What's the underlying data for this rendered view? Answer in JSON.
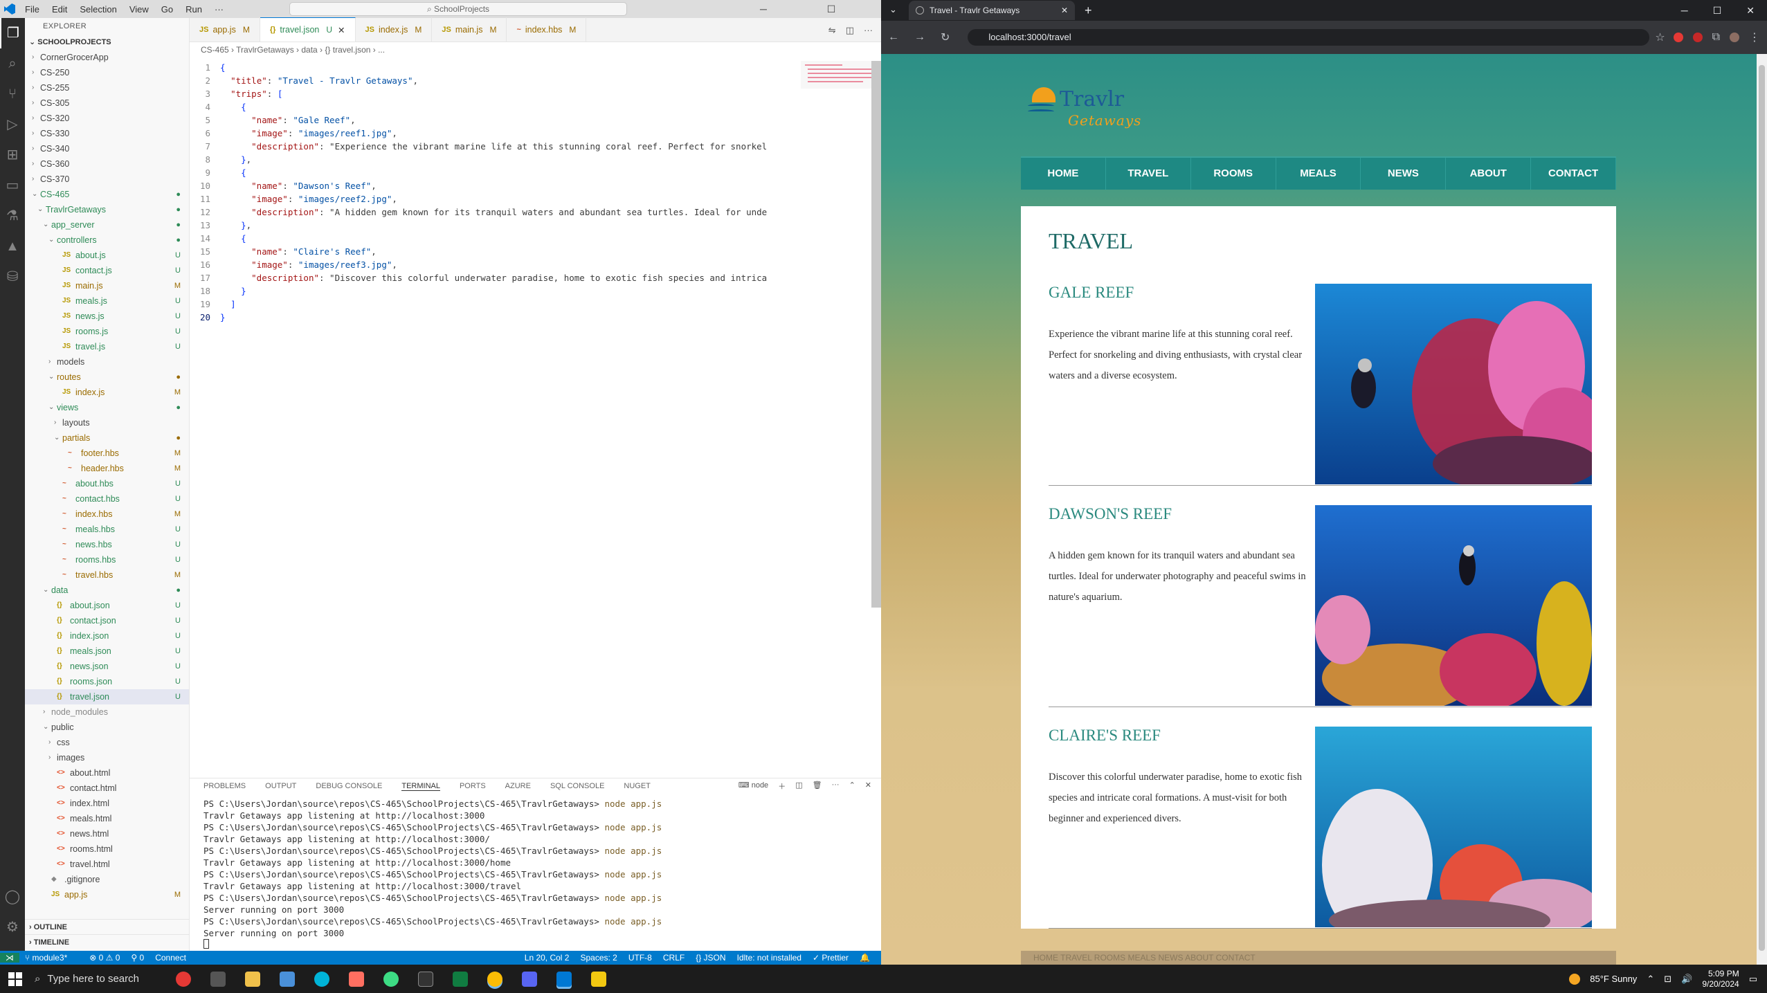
{
  "vscode": {
    "menu": [
      "File",
      "Edit",
      "Selection",
      "View",
      "Go",
      "Run",
      "···"
    ],
    "search_placeholder": "SchoolProjects",
    "explorer_title": "EXPLORER",
    "root": "SCHOOLPROJECTS",
    "tree": [
      {
        "label": "CornerGrocerApp",
        "depth": 1,
        "type": "folder"
      },
      {
        "label": "CS-250",
        "depth": 1,
        "type": "folder"
      },
      {
        "label": "CS-255",
        "depth": 1,
        "type": "folder"
      },
      {
        "label": "CS-305",
        "depth": 1,
        "type": "folder"
      },
      {
        "label": "CS-320",
        "depth": 1,
        "type": "folder"
      },
      {
        "label": "CS-330",
        "depth": 1,
        "type": "folder"
      },
      {
        "label": "CS-340",
        "depth": 1,
        "type": "folder"
      },
      {
        "label": "CS-360",
        "depth": 1,
        "type": "folder"
      },
      {
        "label": "CS-370",
        "depth": 1,
        "type": "folder"
      },
      {
        "label": "CS-465",
        "depth": 1,
        "type": "folder-open",
        "status": "dot"
      },
      {
        "label": "TravlrGetaways",
        "depth": 2,
        "type": "folder-open",
        "status": "dot"
      },
      {
        "label": "app_server",
        "depth": 3,
        "type": "folder-open",
        "status": "dot"
      },
      {
        "label": "controllers",
        "depth": 4,
        "type": "folder-open",
        "status": "dot"
      },
      {
        "label": "about.js",
        "depth": 5,
        "type": "js",
        "status": "U"
      },
      {
        "label": "contact.js",
        "depth": 5,
        "type": "js",
        "status": "U"
      },
      {
        "label": "main.js",
        "depth": 5,
        "type": "js",
        "status": "M"
      },
      {
        "label": "meals.js",
        "depth": 5,
        "type": "js",
        "status": "U"
      },
      {
        "label": "news.js",
        "depth": 5,
        "type": "js",
        "status": "U"
      },
      {
        "label": "rooms.js",
        "depth": 5,
        "type": "js",
        "status": "U"
      },
      {
        "label": "travel.js",
        "depth": 5,
        "type": "js",
        "status": "U"
      },
      {
        "label": "models",
        "depth": 4,
        "type": "folder"
      },
      {
        "label": "routes",
        "depth": 4,
        "type": "folder-open",
        "status": "dot-m"
      },
      {
        "label": "index.js",
        "depth": 5,
        "type": "js",
        "status": "M"
      },
      {
        "label": "views",
        "depth": 4,
        "type": "folder-open",
        "status": "dot"
      },
      {
        "label": "layouts",
        "depth": 5,
        "type": "folder"
      },
      {
        "label": "partials",
        "depth": 5,
        "type": "folder-open",
        "status": "dot-m"
      },
      {
        "label": "footer.hbs",
        "depth": 6,
        "type": "hbs",
        "status": "M"
      },
      {
        "label": "header.hbs",
        "depth": 6,
        "type": "hbs",
        "status": "M"
      },
      {
        "label": "about.hbs",
        "depth": 5,
        "type": "hbs",
        "status": "U"
      },
      {
        "label": "contact.hbs",
        "depth": 5,
        "type": "hbs",
        "status": "U"
      },
      {
        "label": "index.hbs",
        "depth": 5,
        "type": "hbs",
        "status": "M"
      },
      {
        "label": "meals.hbs",
        "depth": 5,
        "type": "hbs",
        "status": "U"
      },
      {
        "label": "news.hbs",
        "depth": 5,
        "type": "hbs",
        "status": "U"
      },
      {
        "label": "rooms.hbs",
        "depth": 5,
        "type": "hbs",
        "status": "U"
      },
      {
        "label": "travel.hbs",
        "depth": 5,
        "type": "hbs",
        "status": "M"
      },
      {
        "label": "data",
        "depth": 3,
        "type": "folder-open",
        "status": "dot"
      },
      {
        "label": "about.json",
        "depth": 4,
        "type": "json",
        "status": "U"
      },
      {
        "label": "contact.json",
        "depth": 4,
        "type": "json",
        "status": "U"
      },
      {
        "label": "index.json",
        "depth": 4,
        "type": "json",
        "status": "U"
      },
      {
        "label": "meals.json",
        "depth": 4,
        "type": "json",
        "status": "U"
      },
      {
        "label": "news.json",
        "depth": 4,
        "type": "json",
        "status": "U"
      },
      {
        "label": "rooms.json",
        "depth": 4,
        "type": "json",
        "status": "U"
      },
      {
        "label": "travel.json",
        "depth": 4,
        "type": "json",
        "status": "U",
        "selected": true
      },
      {
        "label": "node_modules",
        "depth": 3,
        "type": "folder",
        "muted": true
      },
      {
        "label": "public",
        "depth": 3,
        "type": "folder-open"
      },
      {
        "label": "css",
        "depth": 4,
        "type": "folder"
      },
      {
        "label": "images",
        "depth": 4,
        "type": "folder"
      },
      {
        "label": "about.html",
        "depth": 4,
        "type": "html"
      },
      {
        "label": "contact.html",
        "depth": 4,
        "type": "html"
      },
      {
        "label": "index.html",
        "depth": 4,
        "type": "html"
      },
      {
        "label": "meals.html",
        "depth": 4,
        "type": "html"
      },
      {
        "label": "news.html",
        "depth": 4,
        "type": "html"
      },
      {
        "label": "rooms.html",
        "depth": 4,
        "type": "html"
      },
      {
        "label": "travel.html",
        "depth": 4,
        "type": "html"
      },
      {
        "label": ".gitignore",
        "depth": 3,
        "type": "git"
      },
      {
        "label": "app.js",
        "depth": 3,
        "type": "js",
        "status": "M"
      }
    ],
    "outline_label": "OUTLINE",
    "timeline_label": "TIMELINE",
    "tabs": [
      {
        "label": "app.js",
        "status": "M",
        "icon": "JS"
      },
      {
        "label": "travel.json",
        "status": "U",
        "icon": "{}",
        "active": true
      },
      {
        "label": "index.js",
        "status": "M",
        "icon": "JS"
      },
      {
        "label": "main.js",
        "status": "M",
        "icon": "JS"
      },
      {
        "label": "index.hbs",
        "status": "M",
        "icon": "~"
      }
    ],
    "breadcrumb": "CS-465 › TravlrGetaways › data › {} travel.json › ...",
    "code": [
      "{",
      "  \"title\": \"Travel - Travlr Getaways\",",
      "  \"trips\": [",
      "    {",
      "      \"name\": \"Gale Reef\",",
      "      \"image\": \"images/reef1.jpg\",",
      "      \"description\": \"Experience the vibrant marine life at this stunning coral reef. Perfect for snorkel",
      "    },",
      "    {",
      "      \"name\": \"Dawson's Reef\",",
      "      \"image\": \"images/reef2.jpg\",",
      "      \"description\": \"A hidden gem known for its tranquil waters and abundant sea turtles. Ideal for unde",
      "    },",
      "    {",
      "      \"name\": \"Claire's Reef\",",
      "      \"image\": \"images/reef3.jpg\",",
      "      \"description\": \"Discover this colorful underwater paradise, home to exotic fish species and intrica",
      "    }",
      "  ]",
      "}"
    ],
    "panel_tabs": [
      "PROBLEMS",
      "OUTPUT",
      "DEBUG CONSOLE",
      "TERMINAL",
      "PORTS",
      "AZURE",
      "SQL CONSOLE",
      "NUGET"
    ],
    "panel_active": "TERMINAL",
    "terminal_shell": "node",
    "terminal": [
      {
        "prompt": "PS C:\\Users\\Jordan\\source\\repos\\CS-465\\SchoolProjects\\CS-465\\TravlrGetaways>",
        "cmd": " node app.js"
      },
      {
        "text": "Travlr Getaways app listening at http://localhost:3000"
      },
      {
        "prompt": "PS C:\\Users\\Jordan\\source\\repos\\CS-465\\SchoolProjects\\CS-465\\TravlrGetaways>",
        "cmd": " node app.js"
      },
      {
        "text": "Travlr Getaways app listening at http://localhost:3000/"
      },
      {
        "prompt": "PS C:\\Users\\Jordan\\source\\repos\\CS-465\\SchoolProjects\\CS-465\\TravlrGetaways>",
        "cmd": " node app.js"
      },
      {
        "text": "Travlr Getaways app listening at http://localhost:3000/home"
      },
      {
        "prompt": "PS C:\\Users\\Jordan\\source\\repos\\CS-465\\SchoolProjects\\CS-465\\TravlrGetaways>",
        "cmd": " node app.js"
      },
      {
        "text": "Travlr Getaways app listening at http://localhost:3000/travel"
      },
      {
        "prompt": "PS C:\\Users\\Jordan\\source\\repos\\CS-465\\SchoolProjects\\CS-465\\TravlrGetaways>",
        "cmd": " node app.js"
      },
      {
        "text": "Server running on port 3000"
      },
      {
        "prompt": "PS C:\\Users\\Jordan\\source\\repos\\CS-465\\SchoolProjects\\CS-465\\TravlrGetaways>",
        "cmd": " node app.js"
      },
      {
        "text": "Server running on port 3000"
      }
    ],
    "status": {
      "branch": "module3*",
      "problems": "⊗ 0 ⚠ 0",
      "ports": "⚲ 0",
      "connect": "Connect",
      "position": "Ln 20, Col 2",
      "spaces": "Spaces: 2",
      "encoding": "UTF-8",
      "eol": "CRLF",
      "language": "{} JSON",
      "lint": "Idlte: not installed",
      "prettier": "✓ Prettier"
    }
  },
  "browser": {
    "tab_title": "Travel - Travlr Getaways",
    "url": "localhost:3000/travel",
    "site": {
      "logo_top": "Travlr",
      "logo_bottom": "Getaways",
      "nav": [
        "HOME",
        "TRAVEL",
        "ROOMS",
        "MEALS",
        "NEWS",
        "ABOUT",
        "CONTACT"
      ],
      "page_title": "TRAVEL",
      "trips": [
        {
          "name": "GALE REEF",
          "description": "Experience the vibrant marine life at this stunning coral reef. Perfect for snorkeling and diving enthusiasts, with crystal clear waters and a diverse ecosystem."
        },
        {
          "name": "DAWSON'S REEF",
          "description": "A hidden gem known for its tranquil waters and abundant sea turtles. Ideal for underwater photography and peaceful swims in nature's aquarium."
        },
        {
          "name": "CLAIRE'S REEF",
          "description": "Discover this colorful underwater paradise, home to exotic fish species and intricate coral formations. A must-visit for both beginner and experienced divers."
        }
      ],
      "footer_nav": "HOME   TRAVEL   ROOMS   MEALS   NEWS   ABOUT   CONTACT"
    }
  },
  "taskbar": {
    "search_placeholder": "Type here to search",
    "weather": "85°F  Sunny",
    "time": "5:09 PM",
    "date": "9/20/2024"
  },
  "colors": {
    "vscode_status": "#007acc",
    "site_nav": "#1e8983",
    "site_heading": "#2b8a7f"
  }
}
